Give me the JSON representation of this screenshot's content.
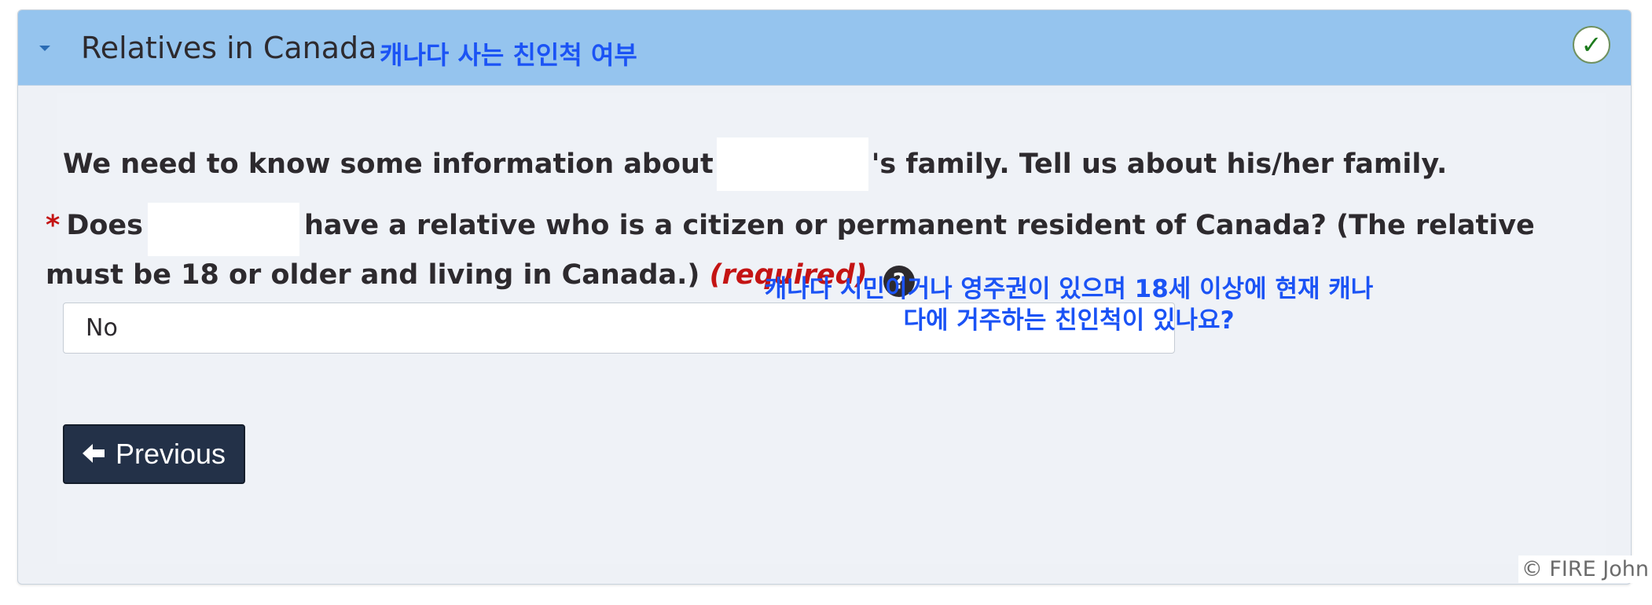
{
  "panel": {
    "title": "Relatives in Canada",
    "title_note": "캐나다 사는 친인척 여부",
    "status_icon": "check-icon",
    "status_mark": "✓"
  },
  "intro": {
    "before": "We need to know some information about",
    "after": "'s family. Tell us about his/her family."
  },
  "question": {
    "required_marker": "*",
    "prefix": "Does",
    "text": "have a relative who is a citizen or permanent resident of Canada? (The relative must be 18 or older and living in Canada.)",
    "required_label": "(required)",
    "help_symbol": "?",
    "note_line1": "캐나다 시민이거나 영주권이 있으며 18세 이상에 현재 캐나",
    "note_line2": "다에 거주하는 친인척이 있나요?"
  },
  "answer": {
    "selected_value": "No"
  },
  "nav": {
    "previous_label": "Previous"
  },
  "footer": {
    "copyright": "© FIRE John"
  },
  "colors": {
    "header_bg": "#95c4ee",
    "annotation_blue": "#1b53f5",
    "required_red": "#c41414",
    "button_bg": "#233148"
  }
}
